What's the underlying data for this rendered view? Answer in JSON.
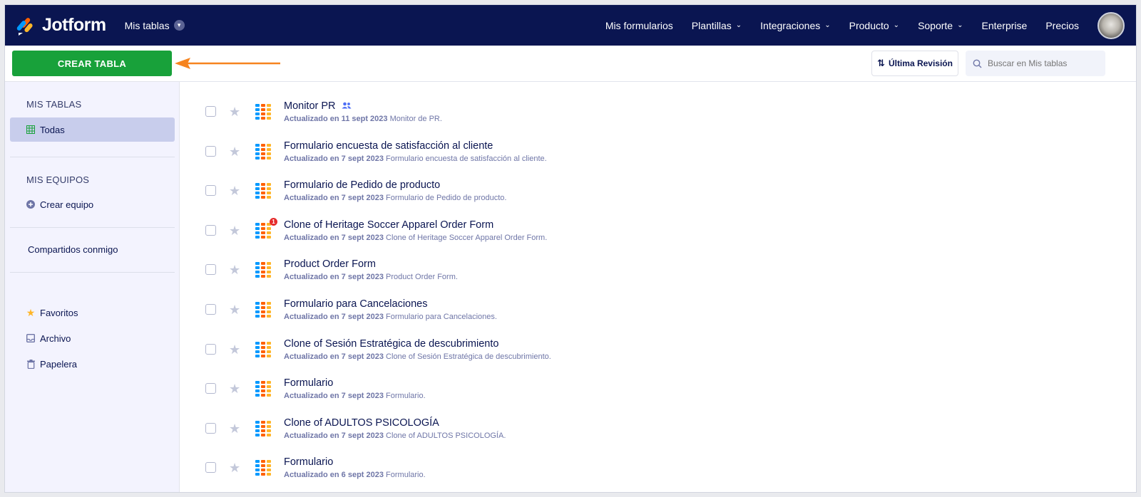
{
  "nav": {
    "brand": "Jotform",
    "workspace": "Mis tablas",
    "links": [
      {
        "label": "Mis formularios",
        "dropdown": false
      },
      {
        "label": "Plantillas",
        "dropdown": true
      },
      {
        "label": "Integraciones",
        "dropdown": true
      },
      {
        "label": "Producto",
        "dropdown": true
      },
      {
        "label": "Soporte",
        "dropdown": true
      },
      {
        "label": "Enterprise",
        "dropdown": false
      },
      {
        "label": "Precios",
        "dropdown": false
      }
    ]
  },
  "toolbar": {
    "create_label": "CREAR TABLA",
    "sort_label": "Última Revisión",
    "search_placeholder": "Buscar en Mis tablas"
  },
  "sidebar": {
    "my_tables_heading": "MIS TABLAS",
    "all_label": "Todas",
    "my_teams_heading": "MIS EQUIPOS",
    "create_team_label": "Crear equipo",
    "shared_label": "Compartidos conmigo",
    "favorites_label": "Favoritos",
    "archive_label": "Archivo",
    "trash_label": "Papelera"
  },
  "colors": {
    "nav_bg": "#0a1551",
    "create_button": "#18a13a",
    "sidebar_bg": "#f3f3fe",
    "active_item": "#c8cdec",
    "arrow": "#f6841f"
  },
  "tables": [
    {
      "title": "Monitor PR",
      "updated": "Actualizado en 11 sept 2023",
      "desc": "Monitor de PR.",
      "shared": true,
      "badge": ""
    },
    {
      "title": "Formulario encuesta de satisfacción al cliente",
      "updated": "Actualizado en 7 sept 2023",
      "desc": "Formulario encuesta de satisfacción al cliente.",
      "shared": false,
      "badge": ""
    },
    {
      "title": "Formulario de Pedido de producto",
      "updated": "Actualizado en 7 sept 2023",
      "desc": "Formulario de Pedido de producto.",
      "shared": false,
      "badge": ""
    },
    {
      "title": "Clone of Heritage Soccer Apparel Order Form",
      "updated": "Actualizado en 7 sept 2023",
      "desc": "Clone of Heritage Soccer Apparel Order Form.",
      "shared": false,
      "badge": "1"
    },
    {
      "title": "Product Order Form",
      "updated": "Actualizado en 7 sept 2023",
      "desc": "Product Order Form.",
      "shared": false,
      "badge": ""
    },
    {
      "title": "Formulario para Cancelaciones",
      "updated": "Actualizado en 7 sept 2023",
      "desc": "Formulario para Cancelaciones.",
      "shared": false,
      "badge": ""
    },
    {
      "title": "Clone of Sesión Estratégica de descubrimiento",
      "updated": "Actualizado en 7 sept 2023",
      "desc": "Clone of Sesión Estratégica de descubrimiento.",
      "shared": false,
      "badge": ""
    },
    {
      "title": "Formulario",
      "updated": "Actualizado en 7 sept 2023",
      "desc": "Formulario.",
      "shared": false,
      "badge": ""
    },
    {
      "title": "Clone of ADULTOS PSICOLOGÍA",
      "updated": "Actualizado en 7 sept 2023",
      "desc": "Clone of ADULTOS PSICOLOGÍA.",
      "shared": false,
      "badge": ""
    },
    {
      "title": "Formulario",
      "updated": "Actualizado en 6 sept 2023",
      "desc": "Formulario.",
      "shared": false,
      "badge": ""
    }
  ]
}
